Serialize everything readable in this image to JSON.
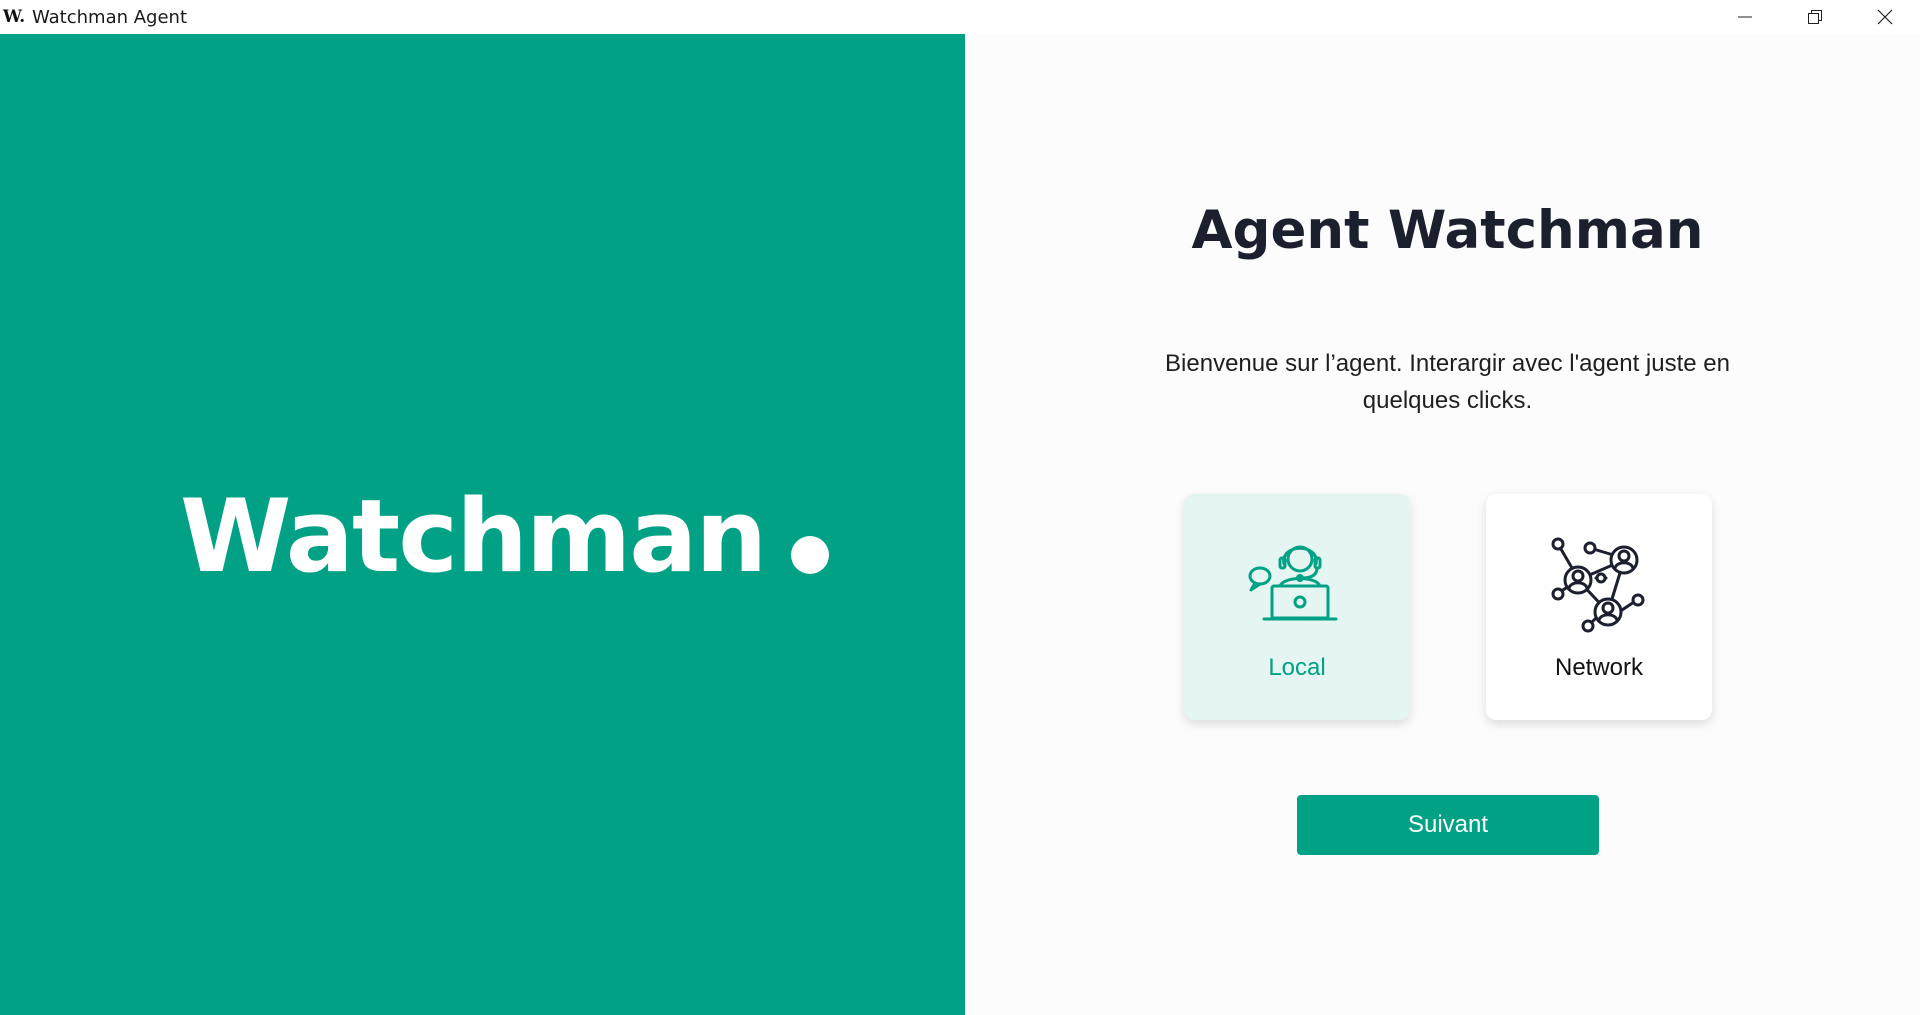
{
  "window": {
    "title": "Watchman Agent",
    "app_icon_letter": "W."
  },
  "brand": {
    "logo_text": "Watchman",
    "color": "#00a185"
  },
  "main": {
    "title": "Agent Watchman",
    "welcome_line1": "Bienvenue sur l’agent. Interargir avec l'agent juste en",
    "welcome_line2": "quelques clicks.",
    "options": [
      {
        "label": "Local",
        "icon": "headset-support-laptop-icon",
        "selected": true
      },
      {
        "label": "Network",
        "icon": "people-network-icon",
        "selected": false
      }
    ],
    "next_label": "Suivant"
  }
}
